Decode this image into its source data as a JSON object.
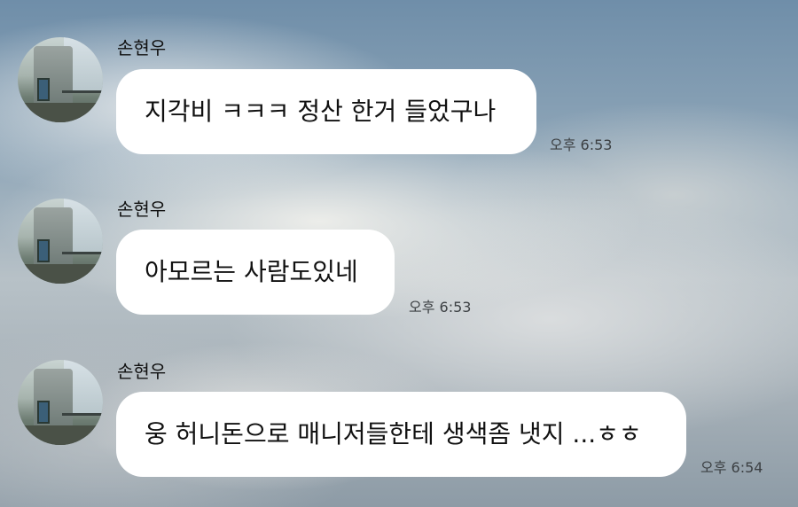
{
  "messages": [
    {
      "sender": "손현우",
      "text": "지각비 ㅋㅋㅋ 정산 한거 들었구나",
      "time": "오후 6:53"
    },
    {
      "sender": "손현우",
      "text": "아모르는 사람도있네",
      "time": "오후 6:53"
    },
    {
      "sender": "손현우",
      "text": "웅 허니돈으로 매니저들한테 생색좀 냇지 ...ㅎㅎ",
      "time": "오후 6:54"
    }
  ]
}
